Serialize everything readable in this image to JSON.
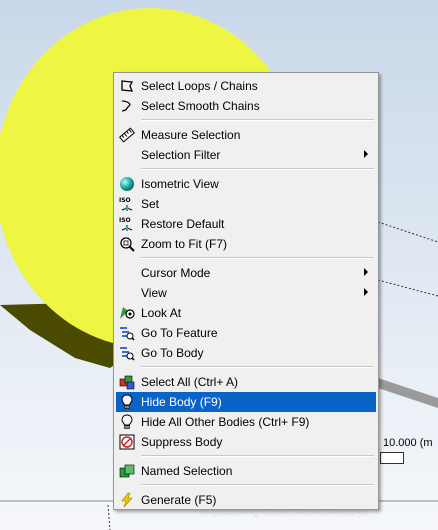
{
  "scene": {
    "scale_label": "10.000 (m",
    "watermark": "https://blog.csdn.net/secretboys"
  },
  "context_menu": {
    "groups": [
      [
        {
          "label": "Select Loops / Chains",
          "icon": "select-loops-icon"
        },
        {
          "label": "Select Smooth Chains",
          "icon": "select-smooth-chains-icon"
        }
      ],
      [
        {
          "label": "Measure Selection",
          "icon": "ruler-icon"
        },
        {
          "label": "Selection Filter",
          "submenu": true
        }
      ],
      [
        {
          "label": "Isometric View",
          "icon": "sphere-icon"
        },
        {
          "label": "Set",
          "icon": "iso-set-icon"
        },
        {
          "label": "Restore Default",
          "icon": "iso-restore-icon"
        },
        {
          "label": "Zoom to Fit (F7)",
          "icon": "zoom-fit-icon"
        }
      ],
      [
        {
          "label": "Cursor Mode",
          "submenu": true
        },
        {
          "label": "View",
          "submenu": true
        },
        {
          "label": "Look At",
          "icon": "look-at-icon"
        },
        {
          "label": "Go To Feature",
          "icon": "go-to-feature-icon"
        },
        {
          "label": "Go To Body",
          "icon": "go-to-body-icon"
        }
      ],
      [
        {
          "label": "Select All (Ctrl+ A)",
          "icon": "select-all-icon"
        },
        {
          "label": "Hide Body (F9)",
          "icon": "lightbulb-icon",
          "highlighted": true
        },
        {
          "label": "Hide All Other Bodies (Ctrl+ F9)",
          "icon": "lightbulb-icon"
        },
        {
          "label": "Suppress Body",
          "icon": "suppress-body-icon"
        }
      ],
      [
        {
          "label": "Named Selection",
          "icon": "named-selection-icon"
        }
      ],
      [
        {
          "label": "Generate (F5)",
          "icon": "lightning-icon"
        }
      ]
    ]
  },
  "colors": {
    "highlight": "#0a64c8",
    "disk_face": "#eef542",
    "disk_side": "#4a4a00",
    "menu_bg": "#f0f0f0"
  }
}
